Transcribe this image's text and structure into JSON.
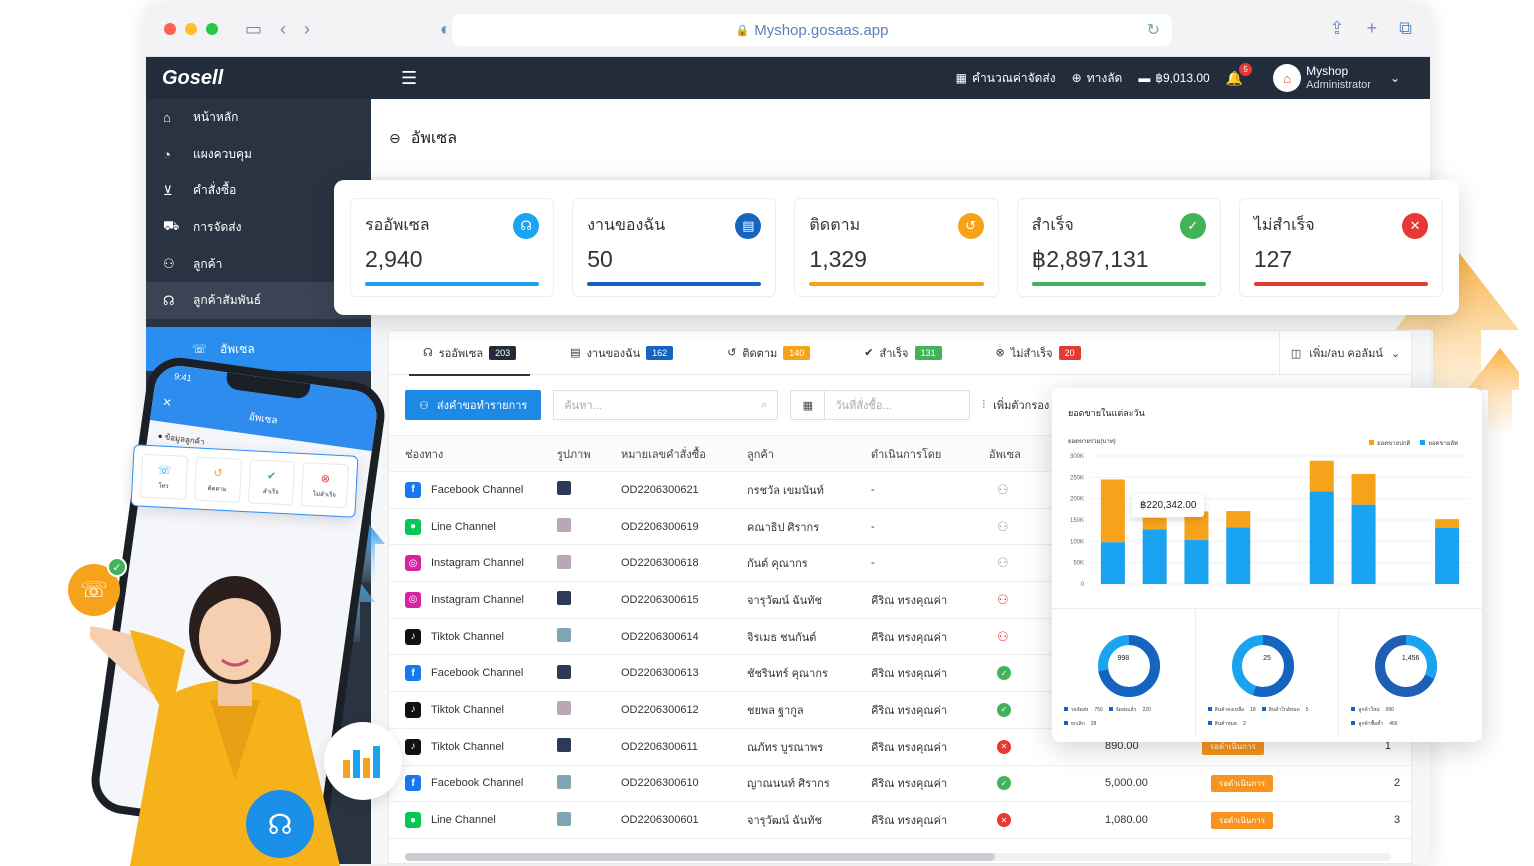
{
  "browser": {
    "url": "Myshop.gosaas.app"
  },
  "topbar": {
    "logo": "Gosell",
    "shipping_calc": "คำนวณค่าจัดส่ง",
    "shortcut": "ทางลัด",
    "balance": "฿9,013.00",
    "notif_count": "5",
    "shop_name": "Myshop",
    "shop_role": "Administrator"
  },
  "sidebar": {
    "items": [
      {
        "label": "หน้าหลัก",
        "icon": "home-icon"
      },
      {
        "label": "แผงควบคุม",
        "icon": "dashboard-icon"
      },
      {
        "label": "คำสั่งซื้อ",
        "icon": "cart-icon"
      },
      {
        "label": "การจัดส่ง",
        "icon": "truck-icon"
      },
      {
        "label": "ลูกค้า",
        "icon": "users-icon"
      },
      {
        "label": "ลูกค้าสัมพันธ์",
        "icon": "headset-icon"
      }
    ],
    "sub_active": "อัพเซล"
  },
  "page": {
    "title": "อัพเซล"
  },
  "kpis": [
    {
      "label": "รออัพเซล",
      "value": "2,940",
      "color": "#1aa3f0"
    },
    {
      "label": "งานของฉัน",
      "value": "50",
      "color": "#1565c0"
    },
    {
      "label": "ติดตาม",
      "value": "1,329",
      "color": "#f7a21b"
    },
    {
      "label": "สำเร็จ",
      "value": "฿2,897,131",
      "color": "#43b35a"
    },
    {
      "label": "ไม่สำเร็จ",
      "value": "127",
      "color": "#e53935"
    }
  ],
  "tabs": [
    {
      "label": "รออัพเซล",
      "count": "203",
      "color": "#232c3b"
    },
    {
      "label": "งานของฉัน",
      "count": "162",
      "color": "#1565c0"
    },
    {
      "label": "ติดตาม",
      "count": "140",
      "color": "#f7a21b"
    },
    {
      "label": "สำเร็จ",
      "count": "131",
      "color": "#43b35a"
    },
    {
      "label": "ไม่สำเร็จ",
      "count": "20",
      "color": "#e53935"
    }
  ],
  "column_toggle": "เพิ่ม/ลบ คอลัมน์",
  "toolbar": {
    "assign_button": "ส่งคำขอทำรายการ",
    "search_placeholder": "ค้นหา...",
    "date_placeholder": "วันที่สั่งซื้อ...",
    "filter_label": "เพิ่มตัวกรอง"
  },
  "table": {
    "headers": [
      "ช่องทาง",
      "รูปภาพ",
      "หมายเลขคำสั่งซื้อ",
      "ลูกค้า",
      "ดำเนินการโดย",
      "อัพเซล"
    ],
    "rows": [
      {
        "channel": "Facebook Channel",
        "ch": "fb",
        "shirt": "#2b3a55",
        "order": "OD2206300621",
        "customer": "กรชวัล เขมนันท์",
        "by": "-",
        "status": "wait"
      },
      {
        "channel": "Line Channel",
        "ch": "line",
        "shirt": "#b9a7b8",
        "order": "OD2206300619",
        "customer": "คณาธิป ศิรากร",
        "by": "-",
        "status": "wait"
      },
      {
        "channel": "Instagram Channel",
        "ch": "ig",
        "shirt": "#b9a7b8",
        "order": "OD2206300618",
        "customer": "กันต์ คุณากร",
        "by": "-",
        "status": "wait"
      },
      {
        "channel": "Instagram Channel",
        "ch": "ig",
        "shirt": "#2b3a55",
        "order": "OD2206300615",
        "customer": "จารุวัฒน์ ฉันทัช",
        "by": "คีริณ ทรงคุณค่า",
        "status": "user-red"
      },
      {
        "channel": "Tiktok Channel",
        "ch": "tt",
        "shirt": "#7fa6b5",
        "order": "OD2206300614",
        "customer": "จิรเมธ ชนกันต์",
        "by": "คีริณ ทรงคุณค่า",
        "status": "user-red"
      },
      {
        "channel": "Facebook Channel",
        "ch": "fb",
        "shirt": "#2b3a55",
        "order": "OD2206300613",
        "customer": "ชัชรินทร์ คุณากร",
        "by": "คีริณ ทรงคุณค่า",
        "status": "ok"
      },
      {
        "channel": "Tiktok Channel",
        "ch": "tt",
        "shirt": "#b9a7b8",
        "order": "OD2206300612",
        "customer": "ชยพล ฐากูล",
        "by": "คีริณ ทรงคุณค่า",
        "status": "ok"
      },
      {
        "channel": "Tiktok Channel",
        "ch": "tt",
        "shirt": "#2b3a55",
        "order": "OD2206300611",
        "customer": "ณภัทร บูรณาพร",
        "by": "คีริณ ทรงคุณค่า",
        "status": "fail",
        "amount": "890.00",
        "qty": "1"
      },
      {
        "channel": "Facebook Channel",
        "ch": "fb",
        "shirt": "#7fa6b5",
        "order": "OD2206300610",
        "customer": "ญาณนนท์ ศิรากร",
        "by": "คีริณ ทรงคุณค่า",
        "status": "ok",
        "amount": "5,000.00",
        "qty": "2"
      },
      {
        "channel": "Line Channel",
        "ch": "line",
        "shirt": "#7fa6b5",
        "order": "OD2206300601",
        "customer": "จารุวัฒน์ ฉันทัช",
        "by": "คีริณ ทรงคุณค่า",
        "status": "fail",
        "amount": "1,080.00",
        "qty": "3"
      }
    ],
    "op_badge": "รอดำเนินการ"
  },
  "chart_card": {
    "title": "ยอดขายในแต่ละวัน",
    "ylabel": "ยอดขายรวม(บาท)",
    "legend": [
      "ยอดขายปกติ",
      "ยอดขายอัพ"
    ],
    "tooltip_value": "฿220,342.00",
    "donuts": [
      {
        "center": "998",
        "legend": [
          "รอจัดส่ง",
          "750",
          "จัดส่งแล้ว",
          "220",
          "ยกเลิก",
          "28"
        ]
      },
      {
        "center": "25",
        "legend": [
          "สินค้าคงเหลือ",
          "18",
          "สินค้าใกล้หมด",
          "5",
          "สินค้าหมด",
          "2"
        ]
      },
      {
        "center": "1,456",
        "legend": [
          "ลูกค้าใหม่",
          "990",
          "ลูกค้าซื้อซ้ำ",
          "466"
        ]
      }
    ]
  },
  "chart_data": {
    "type": "bar",
    "title": "ยอดขายในแต่ละวัน",
    "ylabel": "ยอดขายรวม(บาท)",
    "ylim": [
      0,
      300000
    ],
    "yticks": [
      "300K",
      "250K",
      "200K",
      "150K",
      "100K",
      "50K",
      "0"
    ],
    "categories": [
      "",
      "",
      "",
      "",
      "",
      "",
      "",
      "",
      ""
    ],
    "series": [
      {
        "name": "ยอดขายอัพ",
        "color": "#1aa3f0",
        "values": [
          98000,
          128000,
          103000,
          133000,
          0,
          217000,
          186000,
          0,
          132000
        ]
      },
      {
        "name": "ยอดขายปกติ",
        "color": "#f7a21b",
        "values": [
          147000,
          27000,
          67000,
          38000,
          0,
          72000,
          72000,
          0,
          20000
        ]
      }
    ]
  },
  "phone": {
    "time": "9:41",
    "title": "อัพเซล",
    "section": "ข้อมูลลูกค้า"
  },
  "action_card": [
    "โทร",
    "ติดตาม",
    "สำเร็จ",
    "ไม่สำเร็จ"
  ]
}
